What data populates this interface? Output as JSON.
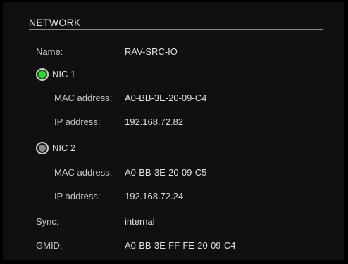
{
  "section": {
    "title": "NETWORK"
  },
  "device": {
    "name_label": "Name:",
    "name_value": "RAV-SRC-IO"
  },
  "nics": [
    {
      "label": "NIC 1",
      "status": "active",
      "led_color": "#2fd62f",
      "mac_label": "MAC address:",
      "mac_value": "A0-BB-3E-20-09-C4",
      "ip_label": "IP address:",
      "ip_value": "192.168.72.82"
    },
    {
      "label": "NIC 2",
      "status": "inactive",
      "led_color": "#8c8c8c",
      "mac_label": "MAC address:",
      "mac_value": "A0-BB-3E-20-09-C5",
      "ip_label": "IP address:",
      "ip_value": "192.168.72.24"
    }
  ],
  "sync": {
    "label": "Sync:",
    "value": "internal"
  },
  "gmid": {
    "label": "GMID:",
    "value": "A0-BB-3E-FF-FE-20-09-C4"
  }
}
